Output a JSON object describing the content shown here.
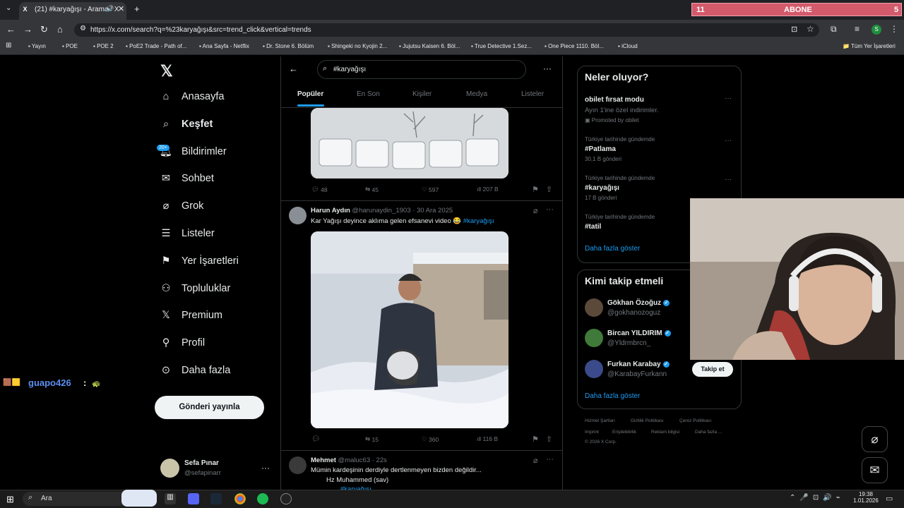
{
  "browser": {
    "tab_title": "(21) #karyağışı - Arama / X",
    "url": "https://x.com/search?q=%23karyağışı&src=trend_click&vertical=trends",
    "new_tab": "+"
  },
  "overlay": {
    "left": "11",
    "center": "ABONE",
    "right": "5"
  },
  "bookmarks": [
    "Yayın",
    "POE",
    "POE 2",
    "PoE2 Trade - Path of...",
    "Ana Sayfa - Netflix",
    "Dr. Stone 6. Bölüm",
    "Shingeki no Kyojin 2...",
    "Jujutsu Kaisen 6. Böl...",
    "True Detective 1.Sez...",
    "One Piece 1110. Böl...",
    "iCloud"
  ],
  "bookmarks_all": "Tüm Yer İşaretleri",
  "sidebar": {
    "items": [
      {
        "label": "Anasayfa",
        "icon": "home-icon"
      },
      {
        "label": "Keşfet",
        "icon": "search-icon",
        "active": true
      },
      {
        "label": "Bildirimler",
        "icon": "bell-icon",
        "badge": "20+"
      },
      {
        "label": "Sohbet",
        "icon": "mail-icon"
      },
      {
        "label": "Grok",
        "icon": "grok-icon"
      },
      {
        "label": "Listeler",
        "icon": "list-icon"
      },
      {
        "label": "Yer İşaretleri",
        "icon": "bookmark-icon"
      },
      {
        "label": "Topluluklar",
        "icon": "people-icon"
      },
      {
        "label": "Premium",
        "icon": "x-icon"
      },
      {
        "label": "Profil",
        "icon": "person-icon"
      },
      {
        "label": "Daha fazla",
        "icon": "more-icon"
      }
    ],
    "post_button": "Gönderi yayınla",
    "user": {
      "name": "Sefa Pınar",
      "handle": "@sefapinarr"
    }
  },
  "chat": {
    "user": "guapo426",
    "sep": ":"
  },
  "search": {
    "value": "#karyağışı",
    "tabs": [
      "Popüler",
      "En Son",
      "Kişiler",
      "Medya",
      "Listeler"
    ]
  },
  "posts": [
    {
      "stats": {
        "replies": "48",
        "reposts": "45",
        "likes": "597",
        "views": "207 B"
      }
    },
    {
      "name": "Harun Aydın",
      "handle": "@harunaydin_1903",
      "date": "· 30 Ara 2025",
      "text": "Kar Yağışı deyince aklıma gelen efsanevi video 😂",
      "hashtag": "#karyağışı",
      "stats": {
        "replies": "",
        "reposts": "15",
        "likes": "360",
        "views": "116 B"
      }
    },
    {
      "name": "Mehmet",
      "handle": "@maluc63",
      "date": "· 22s",
      "text": "Mümin kardeşinin derdiyle dertlenmeyen bizden değildir...",
      "text2": "Hz Muhammed (sav)",
      "hashtag": "#karyağışı"
    }
  ],
  "trends": {
    "title": "Neler oluyor?",
    "items": [
      {
        "meta": "",
        "name": "obilet fırsat modu",
        "sub": "Ayın 1'ine özel indirimler.",
        "promo": "Promoted by obilet"
      },
      {
        "meta": "Türkiye tarihinde gündemde",
        "name": "#Patlama",
        "sub": "30,1 B gönderi"
      },
      {
        "meta": "Türkiye tarihinde gündemde",
        "name": "#karyağışı",
        "sub": "17 B gönderi"
      },
      {
        "meta": "Türkiye tarihinde gündemde",
        "name": "#tatil",
        "sub": ""
      }
    ],
    "more": "Daha fazla göster"
  },
  "who": {
    "title": "Kimi takip etmeli",
    "users": [
      {
        "name": "Gökhan Özoğuz",
        "handle": "@gokhanozoguz"
      },
      {
        "name": "Bircan YILDIRIM",
        "handle": "@Yldrmbrcn_"
      },
      {
        "name": "Furkan Karabay",
        "handle": "@KarabayFurkann"
      }
    ],
    "follow": "Takip et",
    "more": "Daha fazla göster"
  },
  "footer": {
    "links": [
      "Hizmet Şartları",
      "Gizlilik Politikası",
      "Çerez Politikası",
      "Imprint",
      "Erişilebilirlik",
      "Reklam bilgisi",
      "Daha fazla ..."
    ],
    "copy": "© 2026 X Corp."
  },
  "taskbar": {
    "search": "Ara",
    "time": "19:38",
    "date": "1.01.2026"
  },
  "colors": {
    "accent": "#1d9bf0",
    "abone": "#d35a6b"
  }
}
